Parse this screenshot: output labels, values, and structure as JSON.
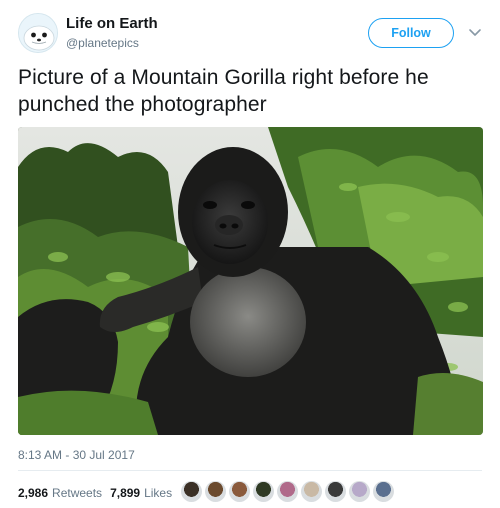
{
  "account": {
    "display_name": "Life on Earth",
    "handle": "@planetepics",
    "avatar_icon": "seal-avatar-icon"
  },
  "header": {
    "follow_label": "Follow",
    "menu_icon": "chevron-down-icon",
    "accent_color": "#1da1f2"
  },
  "tweet": {
    "text": "Picture of a Mountain Gorilla right before he punched the photographer",
    "image_description_icon": "gorilla-photo",
    "timestamp": "8:13 AM - 30 Jul 2017"
  },
  "stats": {
    "retweets_count": "2,986",
    "retweets_label": "Retweets",
    "likes_count": "7,899",
    "likes_label": "Likes"
  },
  "likers": [
    {
      "color": "#3b3026"
    },
    {
      "color": "#6b4a2e"
    },
    {
      "color": "#8a5a3c"
    },
    {
      "color": "#2f3a24"
    },
    {
      "color": "#b06a8a"
    },
    {
      "color": "#c9b9a5"
    },
    {
      "color": "#3a3a3a"
    },
    {
      "color": "#b7a9c9"
    },
    {
      "color": "#5a6f8f"
    }
  ]
}
